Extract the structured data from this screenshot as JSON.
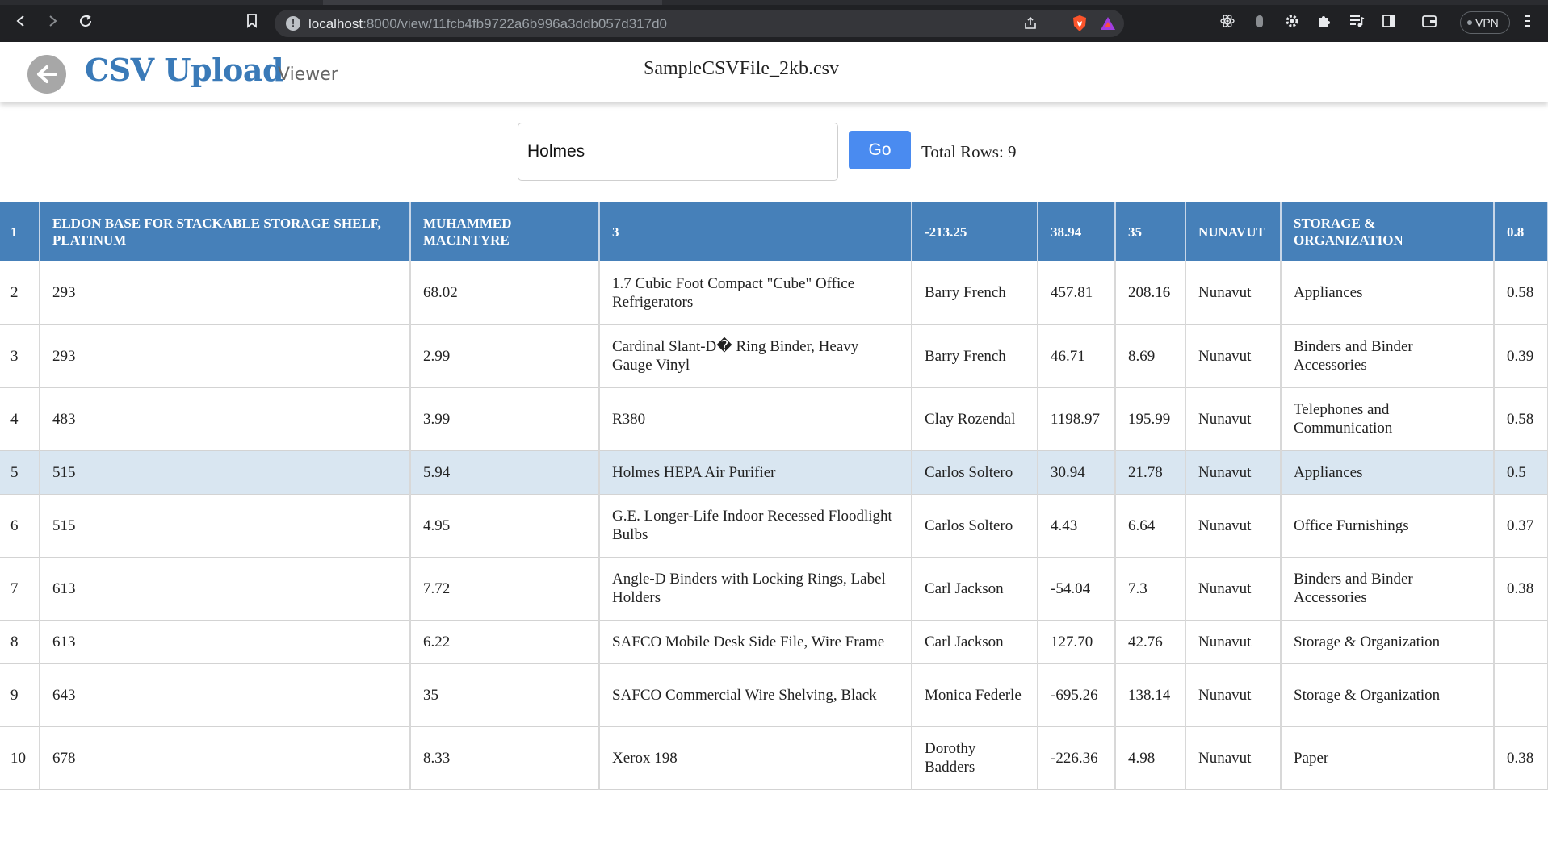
{
  "browser": {
    "url_host": "localhost",
    "url_rest": ":8000/view/11fcb4fb9722a6b996a3ddb057d317d0",
    "vpn_label": "VPN"
  },
  "header": {
    "brand": "CSV Upload",
    "subbrand": "Viewer",
    "filename": "SampleCSVFile_2kb.csv"
  },
  "search": {
    "value": "Holmes",
    "go_label": "Go",
    "total_rows": "Total Rows: 9"
  },
  "table": {
    "columns": [
      "1",
      "ELDON BASE FOR STACKABLE STORAGE SHELF, PLATINUM",
      "MUHAMMED MACINTYRE",
      "3",
      "-213.25",
      "38.94",
      "35",
      "NUNAVUT",
      "STORAGE & ORGANIZATION",
      "0.8"
    ],
    "rows": [
      [
        "2",
        "293",
        "68.02",
        "1.7 Cubic Foot Compact \"Cube\" Office Refrigerators",
        "Barry French",
        "457.81",
        "208.16",
        "Nunavut",
        "Appliances",
        "0.58"
      ],
      [
        "3",
        "293",
        "2.99",
        "Cardinal Slant-D� Ring Binder, Heavy Gauge Vinyl",
        "Barry French",
        "46.71",
        "8.69",
        "Nunavut",
        "Binders and Binder Accessories",
        "0.39"
      ],
      [
        "4",
        "483",
        "3.99",
        "R380",
        "Clay Rozendal",
        "1198.97",
        "195.99",
        "Nunavut",
        "Telephones and Communication",
        "0.58"
      ],
      [
        "5",
        "515",
        "5.94",
        "Holmes HEPA Air Purifier",
        "Carlos Soltero",
        "30.94",
        "21.78",
        "Nunavut",
        "Appliances",
        "0.5"
      ],
      [
        "6",
        "515",
        "4.95",
        "G.E. Longer-Life Indoor Recessed Floodlight Bulbs",
        "Carlos Soltero",
        "4.43",
        "6.64",
        "Nunavut",
        "Office Furnishings",
        "0.37"
      ],
      [
        "7",
        "613",
        "7.72",
        "Angle-D Binders with Locking Rings, Label Holders",
        "Carl Jackson",
        "-54.04",
        "7.3",
        "Nunavut",
        "Binders and Binder Accessories",
        "0.38"
      ],
      [
        "8",
        "613",
        "6.22",
        "SAFCO Mobile Desk Side File, Wire Frame",
        "Carl Jackson",
        "127.70",
        "42.76",
        "Nunavut",
        "Storage & Organization",
        ""
      ],
      [
        "9",
        "643",
        "35",
        "SAFCO Commercial Wire Shelving, Black",
        "Monica Federle",
        "-695.26",
        "138.14",
        "Nunavut",
        "Storage & Organization",
        ""
      ],
      [
        "10",
        "678",
        "8.33",
        "Xerox 198",
        "Dorothy Badders",
        "-226.36",
        "4.98",
        "Nunavut",
        "Paper",
        "0.38"
      ]
    ]
  }
}
